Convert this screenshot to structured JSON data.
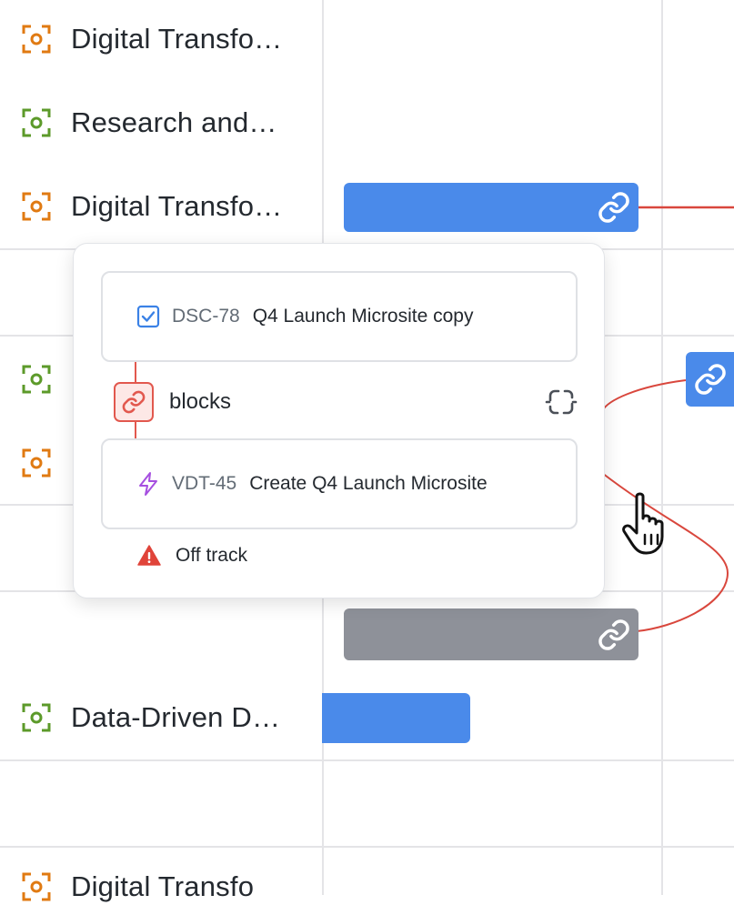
{
  "rows": [
    {
      "label": "Digital Transfo…",
      "icon_color": "#e07a12"
    },
    {
      "label": "Research and…",
      "icon_color": "#5c9a2a"
    },
    {
      "label": "Digital Transfo…",
      "icon_color": "#e07a12"
    },
    {
      "label": "",
      "icon_color": "#5c9a2a"
    },
    {
      "label": "",
      "icon_color": "#e07a12"
    },
    {
      "label": "Data-Driven D…",
      "icon_color": "#5c9a2a"
    },
    {
      "label": "Digital Transfo",
      "icon_color": "#e07a12"
    }
  ],
  "colors": {
    "bar_blue": "#4a8aea",
    "bar_gray": "#8e9199",
    "connector_red": "#d9473d",
    "grid": "#e4e4e7"
  },
  "popup": {
    "source": {
      "key": "DSC-78",
      "title": "Q4 Launch Microsite copy",
      "icon": "checkbox-icon"
    },
    "relation": {
      "label": "blocks",
      "icon": "link-icon",
      "action_icon": "unlink-icon"
    },
    "target": {
      "key": "VDT-45",
      "title": "Create Q4 Launch Microsite",
      "icon": "lightning-icon"
    },
    "status": {
      "label": "Off track",
      "icon": "warning-icon"
    }
  }
}
